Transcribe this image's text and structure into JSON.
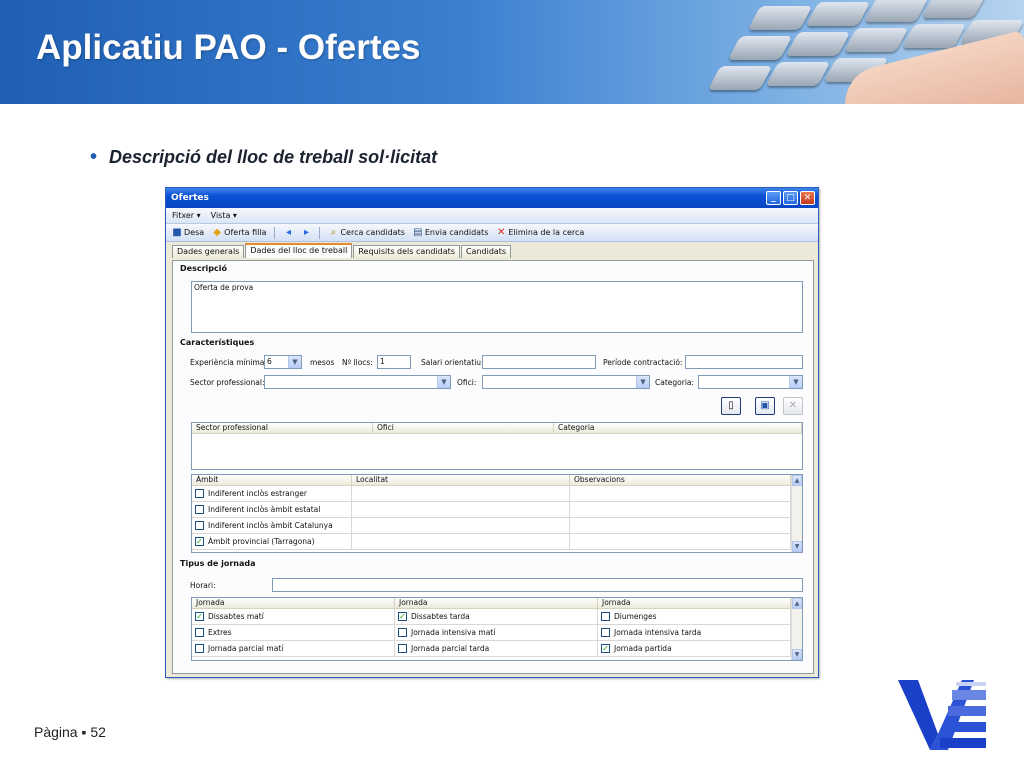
{
  "slide": {
    "title": "Aplicatiu PAO - Ofertes",
    "bullet": "Descripció del lloc de treball sol·licitat",
    "footer_label": "Pàgina",
    "footer_sep": "▪",
    "page_number": "52",
    "colors": {
      "banner": "#1f5fb4",
      "logo": "#1a3fc8"
    }
  },
  "window": {
    "title": "Ofertes",
    "controls": {
      "minimize": "_",
      "maximize": "□",
      "close": "✕"
    },
    "menu": [
      "Fitxer",
      "Vista"
    ],
    "toolbar": {
      "save": "Desa",
      "child_offer": "Oferta filla",
      "search": "Cerca candidats",
      "send": "Envia candidats",
      "delete_search": "Elimina de la cerca"
    },
    "tabs": [
      "Dades generals",
      "Dades del lloc de treball",
      "Requisits dels candidats",
      "Candidats"
    ],
    "active_tab": 1,
    "descripcio": {
      "heading": "Descripció",
      "value": "Oferta de prova"
    },
    "caracteristiques": {
      "heading": "Característiques",
      "experiencia_label": "Experiència mínima:",
      "experiencia_value": "6",
      "mesos_label": "mesos",
      "llocs_label": "Nº llocs:",
      "llocs_value": "1",
      "salari_label": "Salari orientatiu:",
      "salari_value": "",
      "periode_label": "Període contractació:",
      "periode_value": "",
      "sector_label": "Sector professional:",
      "ofici_label": "Ofici:",
      "categoria_label": "Categoria:"
    },
    "sector_grid": {
      "columns": [
        "Sector professional",
        "Ofici",
        "Categoria"
      ]
    },
    "ambit_grid": {
      "columns": [
        "Àmbit",
        "Localitat",
        "Observacions"
      ],
      "rows": [
        {
          "label": "Indiferent inclòs estranger",
          "checked": false
        },
        {
          "label": "Indiferent inclòs àmbit estatal",
          "checked": false
        },
        {
          "label": "Indiferent inclòs àmbit Catalunya",
          "checked": false
        },
        {
          "label": "Àmbit provincial (Tarragona)",
          "checked": true
        }
      ]
    },
    "jornada": {
      "heading": "Tipus de jornada",
      "horari_label": "Horari:",
      "horari_value": "",
      "columns": [
        "Jornada",
        "Jornada",
        "Jornada"
      ],
      "rows": [
        [
          {
            "label": "Dissabtes matí",
            "checked": true
          },
          {
            "label": "Dissabtes tarda",
            "checked": true
          },
          {
            "label": "Diumenges",
            "checked": false
          }
        ],
        [
          {
            "label": "Extres",
            "checked": false
          },
          {
            "label": "Jornada intensiva matí",
            "checked": false
          },
          {
            "label": "Jornada intensiva tarda",
            "checked": false
          }
        ],
        [
          {
            "label": "Jornada parcial matí",
            "checked": false
          },
          {
            "label": "Jornada parcial tarda",
            "checked": false
          },
          {
            "label": "Jornada partida",
            "checked": true
          }
        ]
      ]
    },
    "icons": [
      "save-icon",
      "child-offer-icon",
      "nav-back-icon",
      "nav-forward-icon",
      "search-icon",
      "send-icon",
      "delete-icon",
      "new-icon",
      "edit-icon",
      "remove-icon"
    ]
  }
}
